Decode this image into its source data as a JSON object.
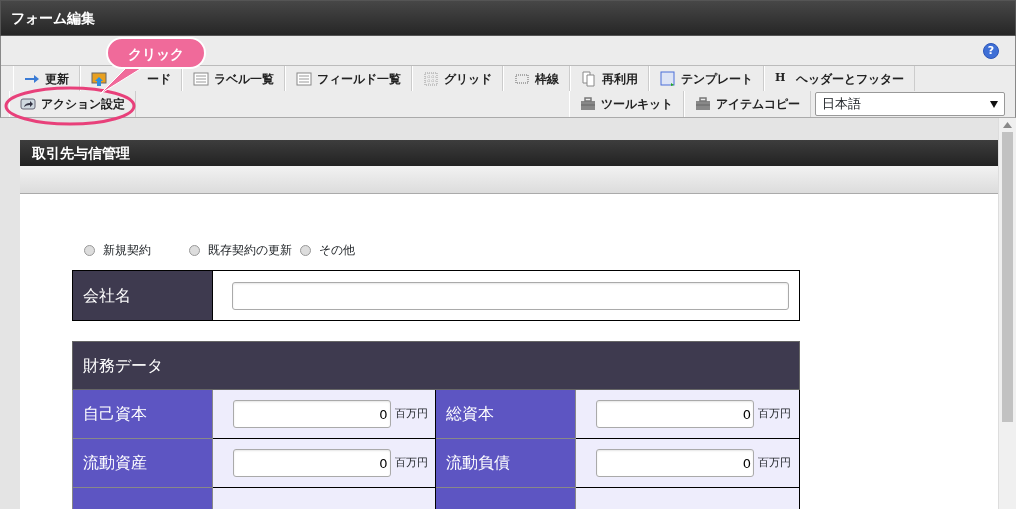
{
  "window": {
    "title": "フォーム編集"
  },
  "help": {
    "glyph": "?"
  },
  "toolbar": {
    "tabs": [
      {
        "label": "更新"
      },
      {
        "label": "ード",
        "covered": true
      },
      {
        "label": "ラベル一覧"
      },
      {
        "label": "フィールド一覧"
      },
      {
        "label": "グリッド"
      },
      {
        "label": "枠線"
      },
      {
        "label": "再利用"
      },
      {
        "label": "テンプレート"
      },
      {
        "label": "ヘッダーとフッター",
        "glyph": "H"
      }
    ],
    "second_row_left": [
      {
        "label": "アクション設定"
      }
    ],
    "second_row_right": [
      {
        "label": "ツールキット"
      },
      {
        "label": "アイテムコピー"
      }
    ],
    "language": {
      "value": "日本語"
    }
  },
  "callout": {
    "text": "クリック"
  },
  "form": {
    "title": "取引先与信管理",
    "radios": [
      {
        "label": "新規契約",
        "selected": false
      },
      {
        "label": "既存契約の更新",
        "selected": false
      },
      {
        "label": "その他",
        "selected": false
      }
    ],
    "company": {
      "label": "会社名"
    },
    "financial": {
      "title": "財務データ",
      "rows": [
        [
          {
            "label": "自己資本",
            "value": "0",
            "unit": "百万円"
          },
          {
            "label": "総資本",
            "value": "0",
            "unit": "百万円"
          }
        ],
        [
          {
            "label": "流動資産",
            "value": "0",
            "unit": "百万円"
          },
          {
            "label": "流動負債",
            "value": "0",
            "unit": "百万円"
          }
        ]
      ]
    }
  }
}
